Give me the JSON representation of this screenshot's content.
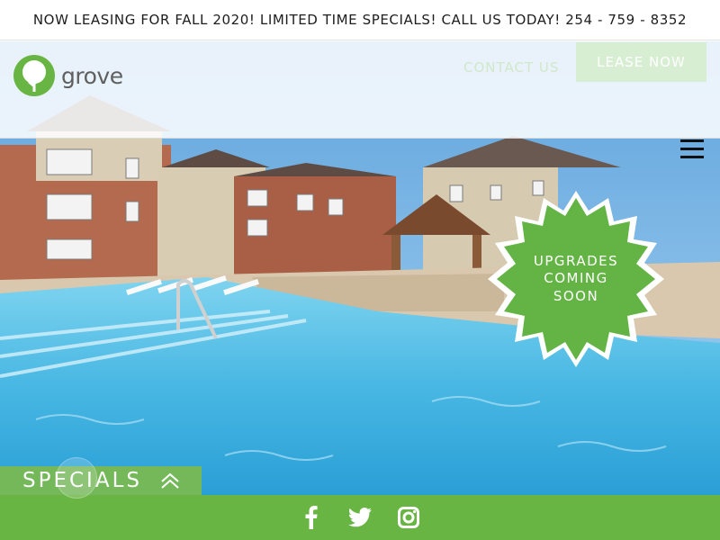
{
  "announcement": {
    "text": "NOW LEASING FOR FALL 2020! LIMITED TIME SPECIALS! CALL US TODAY! 254 - 759 - 8352"
  },
  "brand": {
    "name": "grove",
    "accent": "#69b543"
  },
  "nav": {
    "contact_label": "CONTACT US",
    "lease_label": "LEASE NOW"
  },
  "badge": {
    "lines": [
      "UPGRADES",
      "COMING",
      "SOON"
    ]
  },
  "specials": {
    "label": "SPECIALS"
  },
  "social": [
    "facebook-icon",
    "twitter-icon",
    "instagram-icon"
  ]
}
